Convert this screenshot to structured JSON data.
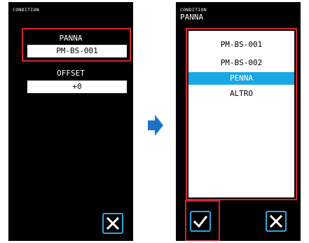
{
  "left_screen": {
    "title": "CONDITION",
    "pen_label": "PANNA",
    "pen_value": "PM-BS-001",
    "offset_label": "OFFSET",
    "offset_value": "+0",
    "cancel_icon": "close-icon"
  },
  "right_screen": {
    "title": "CONDITION",
    "subtitle": "PANNA",
    "options": [
      "PM-BS-001",
      "PM-BS-002",
      "PENNA",
      "ALTRO"
    ],
    "selected_option": "PENNA",
    "confirm_icon": "check-icon",
    "cancel_icon": "close-icon"
  },
  "colors": {
    "accent_blue": "#1aa7e5",
    "highlight_red": "#d9232e",
    "screen_background": "#000000"
  }
}
